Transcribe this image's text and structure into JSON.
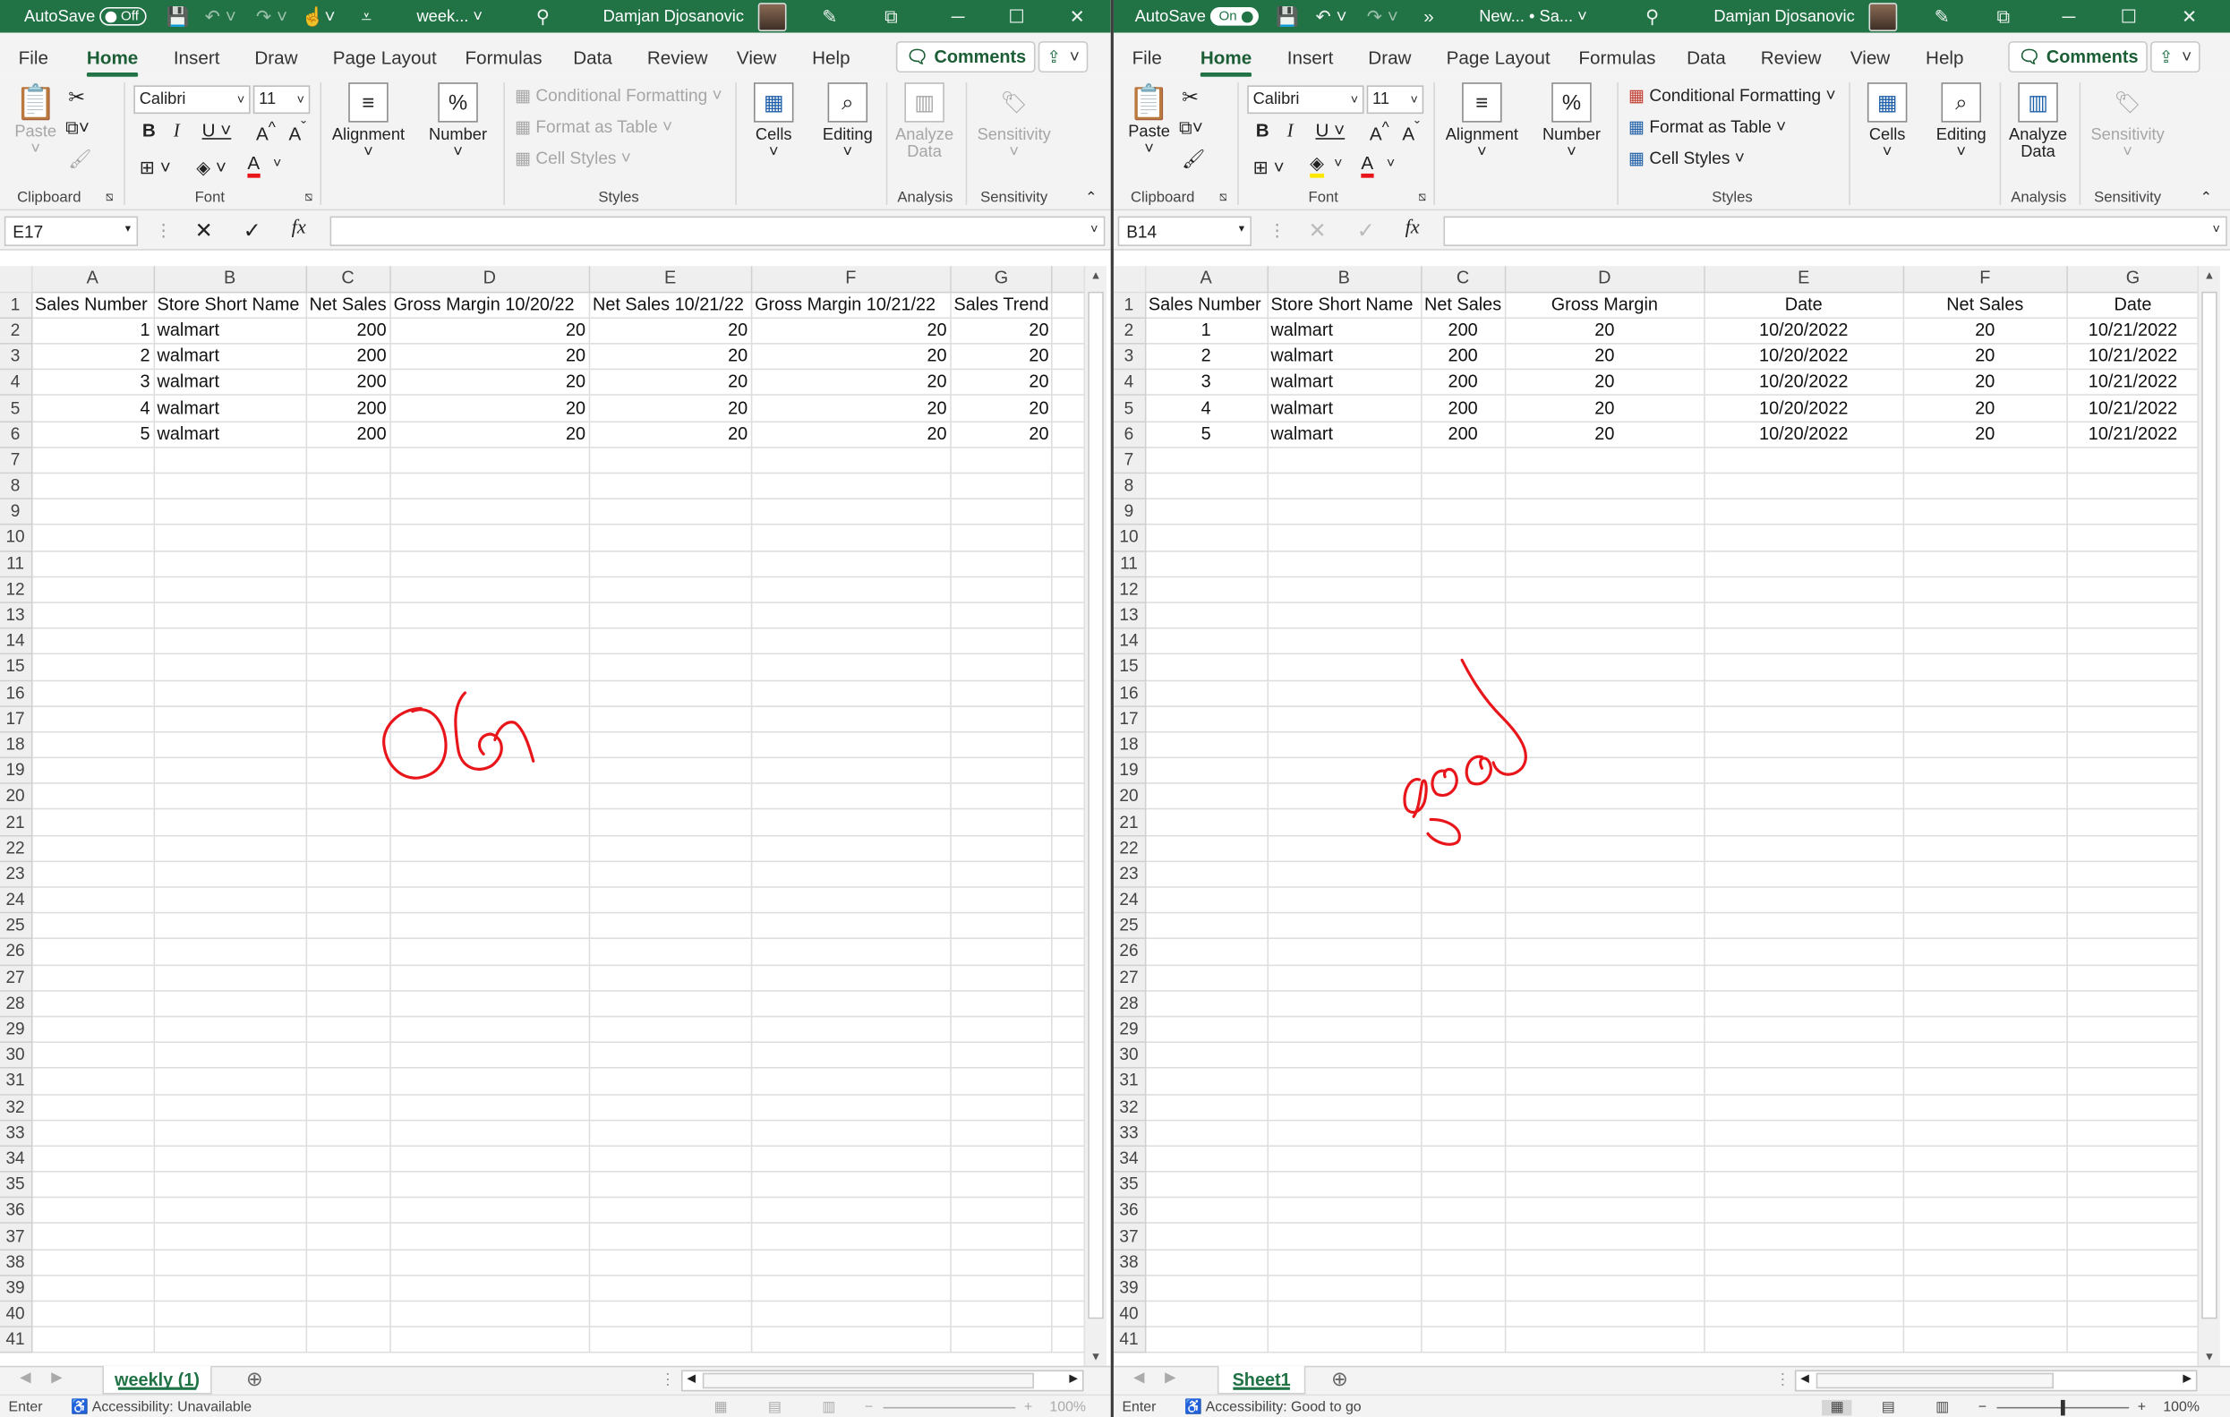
{
  "left": {
    "title": {
      "autosave_label": "AutoSave",
      "autosave_state": "Off",
      "filename": "week...",
      "user": "Damjan Djosanovic"
    },
    "menu": {
      "tabs": [
        "File",
        "Home",
        "Insert",
        "Draw",
        "Page Layout",
        "Formulas",
        "Data",
        "Review",
        "View",
        "Help"
      ],
      "active": "Home",
      "comments": "Comments"
    },
    "ribbon": {
      "paste": "Paste",
      "font_name": "Calibri",
      "font_size": "11",
      "alignment": "Alignment",
      "number": "Number",
      "cond_format": "Conditional Formatting",
      "format_table": "Format as Table",
      "cell_styles": "Cell Styles",
      "cells": "Cells",
      "editing": "Editing",
      "analyze_line1": "Analyze",
      "analyze_line2": "Data",
      "sensitivity": "Sensitivity",
      "groups": {
        "clipboard": "Clipboard",
        "font": "Font",
        "styles": "Styles",
        "analysis": "Analysis",
        "sensitivity": "Sensitivity"
      }
    },
    "formula": {
      "namebox": "E17",
      "content": ""
    },
    "columns": [
      "A",
      "B",
      "C",
      "D",
      "E",
      "F",
      "G"
    ],
    "headers": [
      "Sales Number",
      "Store Short Name",
      "Net Sales",
      "Gross Margin 10/20/22",
      "Net Sales 10/21/22",
      "Gross Margin 10/21/22",
      "Sales Trend"
    ],
    "rows": [
      [
        "1",
        "walmart",
        "200",
        "20",
        "20",
        "20",
        "20"
      ],
      [
        "2",
        "walmart",
        "200",
        "20",
        "20",
        "20",
        "20"
      ],
      [
        "3",
        "walmart",
        "200",
        "20",
        "20",
        "20",
        "20"
      ],
      [
        "4",
        "walmart",
        "200",
        "20",
        "20",
        "20",
        "20"
      ],
      [
        "5",
        "walmart",
        "200",
        "20",
        "20",
        "20",
        "20"
      ]
    ],
    "sheet_tab": "weekly (1)",
    "status": {
      "mode": "Enter",
      "accessibility": "Accessibility: Unavailable",
      "zoom": "100%"
    },
    "ink_note": "OG"
  },
  "right": {
    "title": {
      "autosave_label": "AutoSave",
      "autosave_state": "On",
      "filename": "New... • Sa...",
      "user": "Damjan Djosanovic"
    },
    "menu": {
      "tabs": [
        "File",
        "Home",
        "Insert",
        "Draw",
        "Page Layout",
        "Formulas",
        "Data",
        "Review",
        "View",
        "Help"
      ],
      "active": "Home",
      "comments": "Comments"
    },
    "ribbon": {
      "paste": "Paste",
      "font_name": "Calibri",
      "font_size": "11",
      "alignment": "Alignment",
      "number": "Number",
      "cond_format": "Conditional Formatting",
      "format_table": "Format as Table",
      "cell_styles": "Cell Styles",
      "cells": "Cells",
      "editing": "Editing",
      "analyze_line1": "Analyze",
      "analyze_line2": "Data",
      "sensitivity": "Sensitivity",
      "groups": {
        "clipboard": "Clipboard",
        "font": "Font",
        "styles": "Styles",
        "analysis": "Analysis",
        "sensitivity": "Sensitivity"
      }
    },
    "formula": {
      "namebox": "B14",
      "content": ""
    },
    "columns": [
      "A",
      "B",
      "C",
      "D",
      "E",
      "F",
      "G"
    ],
    "headers": [
      "Sales Number",
      "Store Short Name",
      "Net Sales",
      "Gross Margin",
      "Date",
      "Net Sales",
      "Date"
    ],
    "rows": [
      [
        "1",
        "walmart",
        "200",
        "20",
        "10/20/2022",
        "20",
        "10/21/2022"
      ],
      [
        "2",
        "walmart",
        "200",
        "20",
        "10/20/2022",
        "20",
        "10/21/2022"
      ],
      [
        "3",
        "walmart",
        "200",
        "20",
        "10/20/2022",
        "20",
        "10/21/2022"
      ],
      [
        "4",
        "walmart",
        "200",
        "20",
        "10/20/2022",
        "20",
        "10/21/2022"
      ],
      [
        "5",
        "walmart",
        "200",
        "20",
        "10/20/2022",
        "20",
        "10/21/2022"
      ]
    ],
    "sheet_tab": "Sheet1",
    "status": {
      "mode": "Enter",
      "accessibility": "Accessibility: Good to go",
      "zoom": "100%"
    },
    "ink_note": "good"
  },
  "colors": {
    "excel_green": "#217346",
    "ink_red": "#e8161b",
    "grid": "#dedede",
    "chrome": "#f3f3f3"
  },
  "icons": [
    "autosave-toggle",
    "save-icon",
    "undo-icon",
    "redo-icon",
    "touch-mode-icon",
    "customize-icon",
    "search-icon",
    "pen-icon",
    "ribbon-display-icon",
    "minimize-icon",
    "maximize-icon",
    "close-icon",
    "comments-icon",
    "share-icon",
    "paste-icon",
    "cut-icon",
    "copy-icon",
    "format-painter-icon",
    "bold-icon",
    "italic-icon",
    "underline-icon",
    "borders-icon",
    "fill-color-icon",
    "font-color-icon",
    "alignment-icon",
    "number-icon",
    "cells-icon",
    "editing-icon",
    "analyze-data-icon",
    "sensitivity-icon",
    "cancel-icon",
    "enter-icon",
    "fx-icon"
  ]
}
